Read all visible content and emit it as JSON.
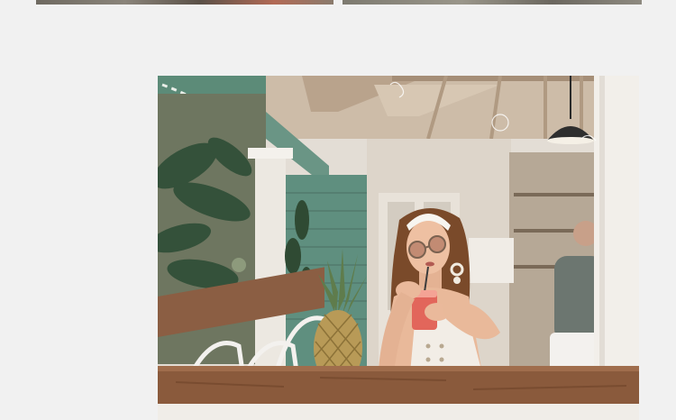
{
  "page": {
    "background": "#f1f1f1"
  },
  "thumbnails": [
    {
      "name": "top-left-thumbnail"
    },
    {
      "name": "top-right-thumbnail"
    }
  ],
  "photo": {
    "description_icon": "photo-image",
    "colors": {
      "ceiling": "#c9b7a3",
      "wall_green": "#5f8d7d",
      "wall_cream": "#e5ded5",
      "counter": "#8a5a3c",
      "skin": "#e9b99a",
      "hair": "#7a4a2a",
      "outfit": "#f2ede6",
      "drink": "#e2665b",
      "pineapple": "#b89a57",
      "foliage": "#3f5b3d"
    }
  }
}
